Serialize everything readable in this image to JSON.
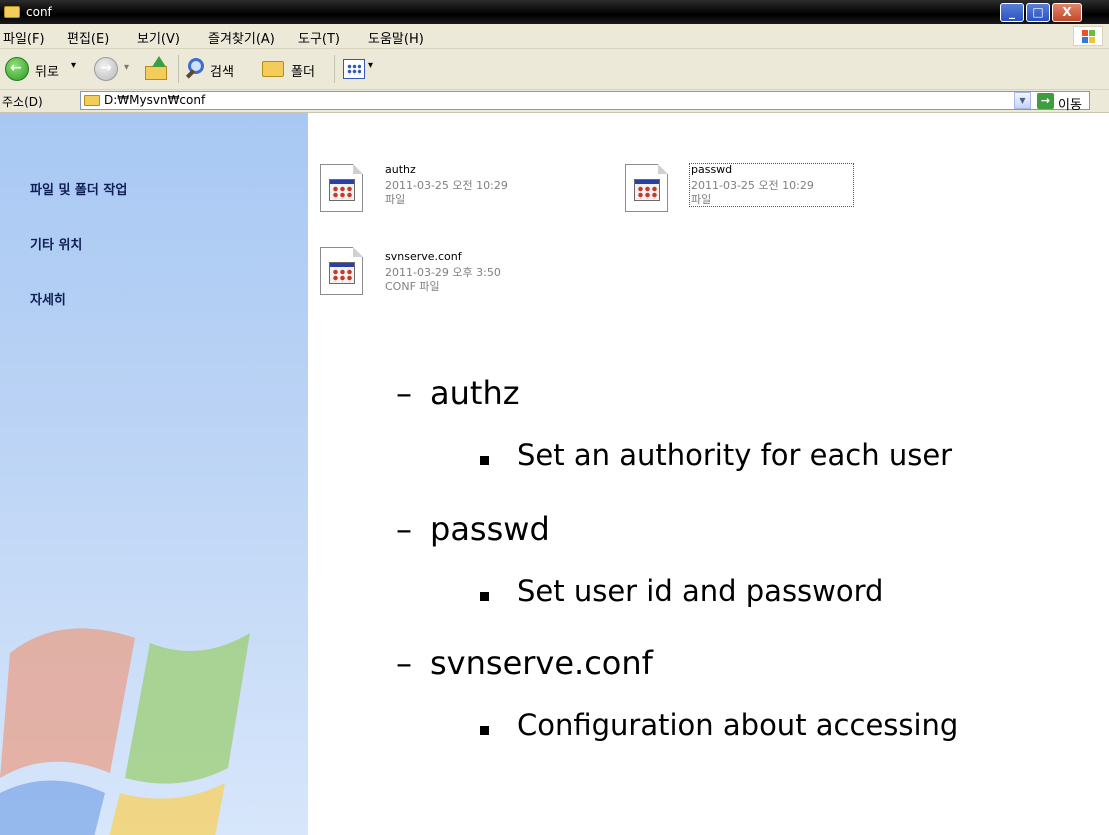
{
  "window": {
    "title": "conf",
    "controls": {
      "minimize": "_",
      "maximize": "□",
      "close": "X"
    }
  },
  "menu": [
    {
      "label": "파일(F)"
    },
    {
      "label": "편집(E)"
    },
    {
      "label": "보기(V)"
    },
    {
      "label": "즐겨찾기(A)"
    },
    {
      "label": "도구(T)"
    },
    {
      "label": "도움말(H)"
    }
  ],
  "toolbar": {
    "back_label": "뒤로",
    "search_label": "검색",
    "folders_label": "폴더",
    "icons": [
      "back-icon",
      "forward-icon",
      "up-folder-icon",
      "search-icon",
      "folders-icon",
      "views-icon"
    ]
  },
  "address": {
    "label": "주소(D)",
    "value": "D:₩Mysvn₩conf",
    "go_label": "이동"
  },
  "taskpane": {
    "sections": [
      {
        "title": "파일 및 폴더 작업"
      },
      {
        "title": "기타 위치"
      },
      {
        "title": "자세히"
      }
    ]
  },
  "files": [
    {
      "name": "authz",
      "date": "2011-03-25 오전 10:29",
      "type": "파일",
      "selected": false
    },
    {
      "name": "passwd",
      "date": "2011-03-25 오전 10:29",
      "type": "파일",
      "selected": true
    },
    {
      "name": "svnserve.conf",
      "date": "2011-03-29 오후 3:50",
      "type": "CONF 파일",
      "selected": false
    }
  ],
  "overlay": {
    "items": [
      {
        "heading": "authz",
        "detail": "Set an authority for each user"
      },
      {
        "heading": "passwd",
        "detail": "Set user id and password"
      },
      {
        "heading": "svnserve.conf",
        "detail": "Configuration about accessing"
      }
    ]
  },
  "colors": {
    "titlebar": "#000000",
    "chrome": "#ece9d8",
    "taskpane": "#bcd4f5",
    "taskpane_title": "#0f1f55"
  }
}
